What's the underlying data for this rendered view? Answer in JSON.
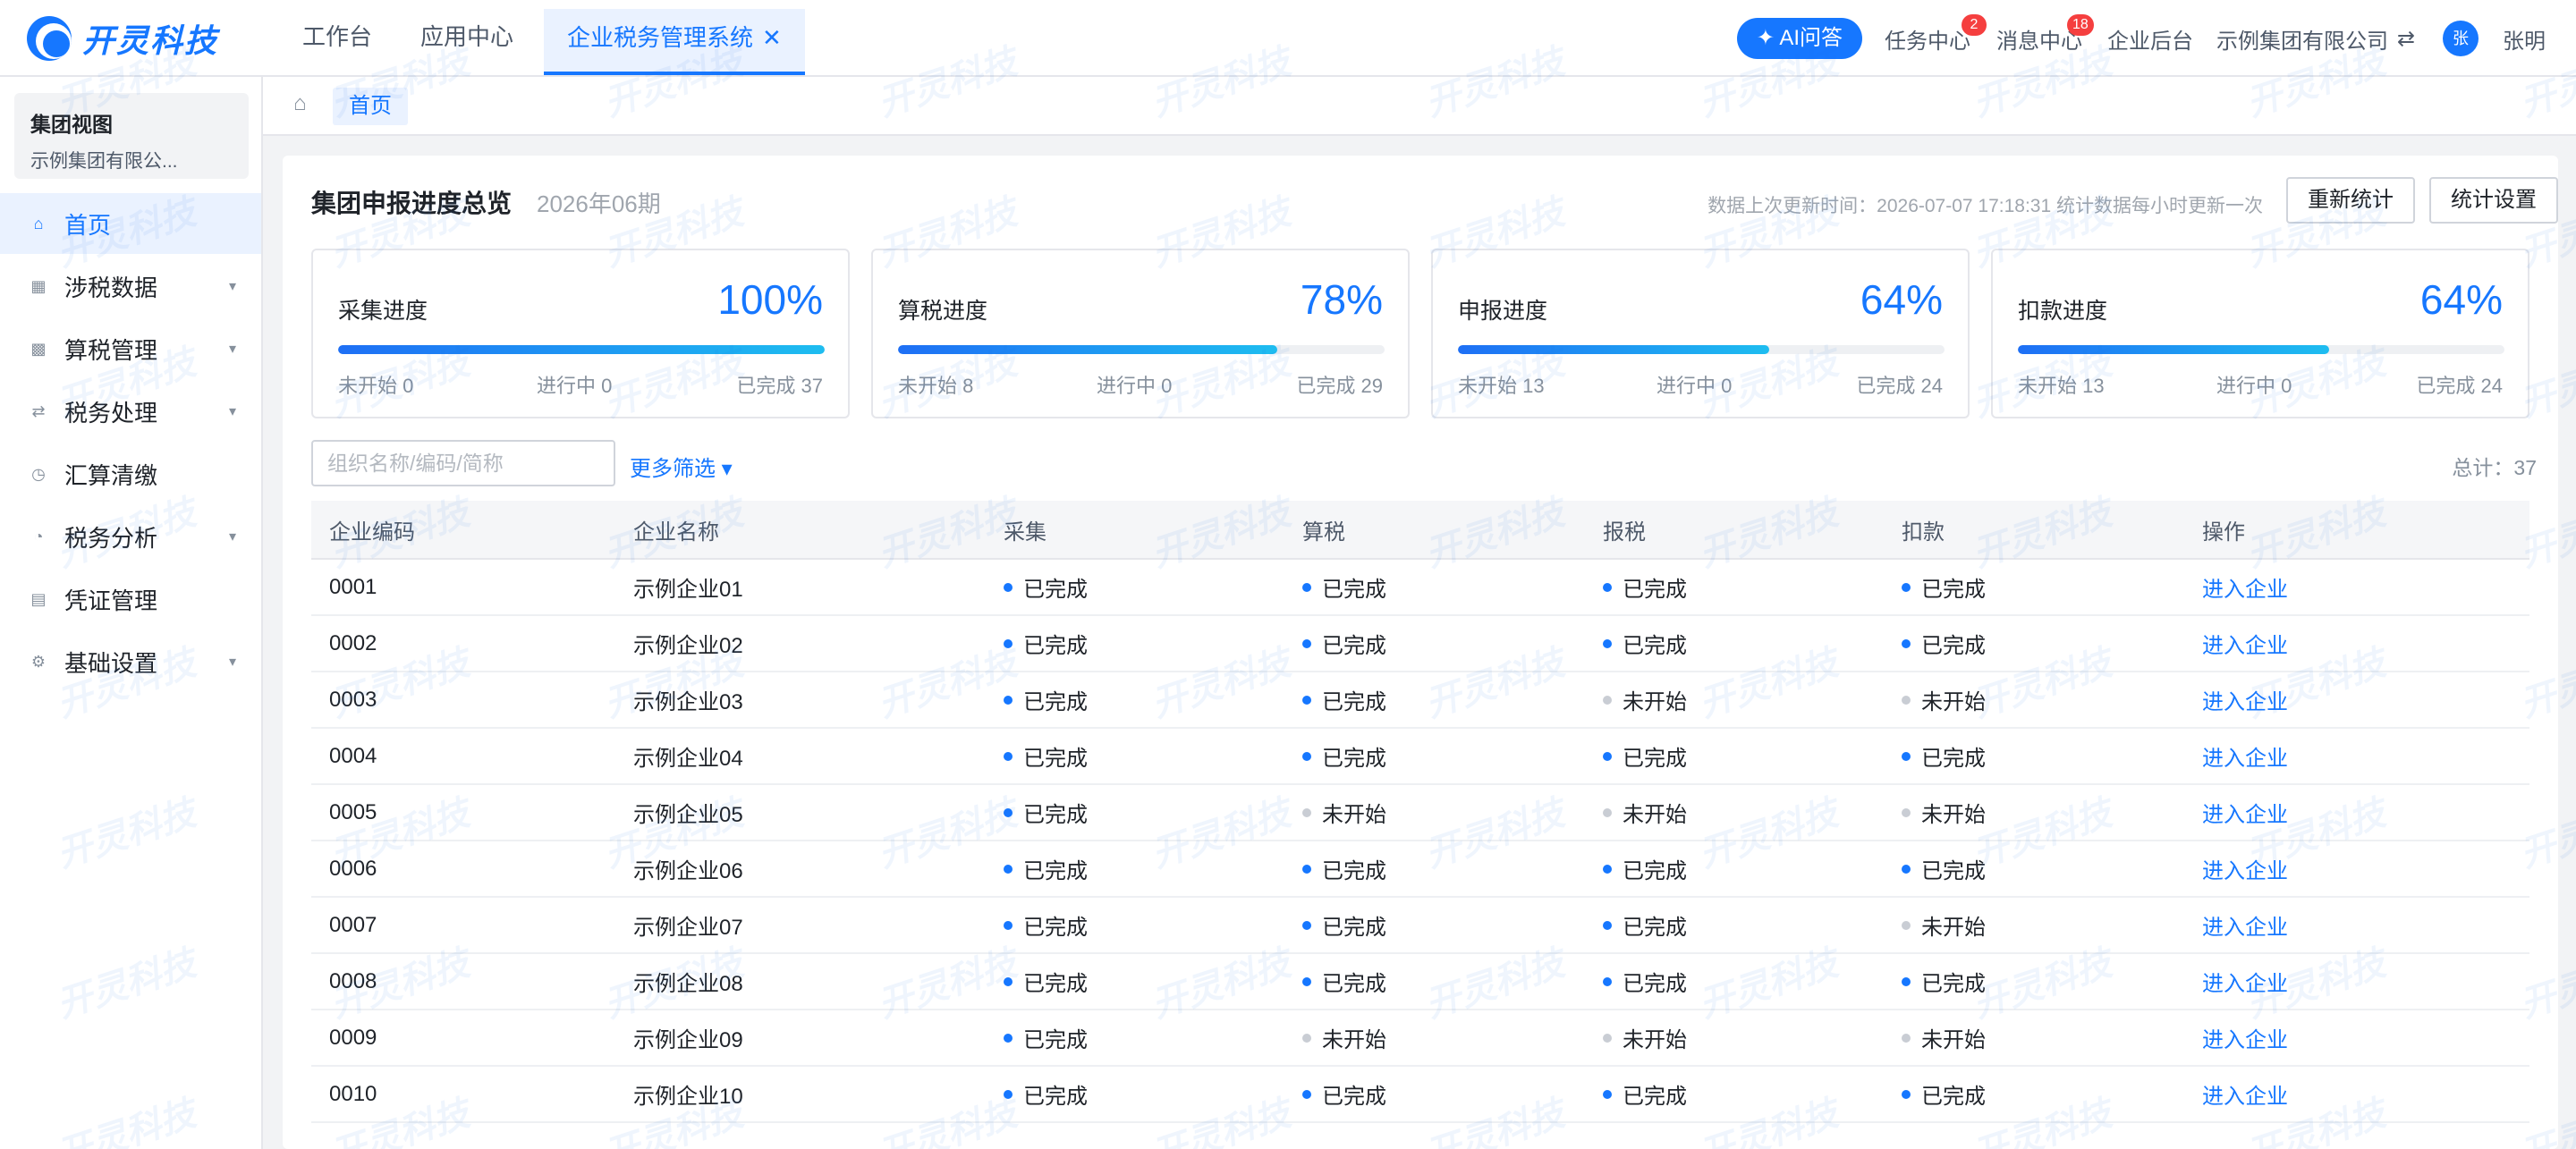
{
  "brand": {
    "name": "开灵科技"
  },
  "topnav": {
    "items": [
      {
        "label": "工作台"
      },
      {
        "label": "应用中心"
      },
      {
        "label": "企业税务管理系统"
      }
    ],
    "close_glyph": "✕"
  },
  "header": {
    "ai_label": "✦ AI问答",
    "tasks_label": "任务中心",
    "tasks_badge": "2",
    "messages_label": "消息中心",
    "messages_badge": "18",
    "admin_label": "企业后台",
    "company_label": "示例集团有限公司",
    "switch_glyph": "⇄",
    "avatar_char": "张",
    "user_name": "张明"
  },
  "sidebar": {
    "group_title": "集团视图",
    "group_sub": "示例集团有限公...",
    "items": [
      {
        "label": "首页",
        "icon": "home-icon",
        "glyph": "⌂",
        "has_children": false
      },
      {
        "label": "涉税数据",
        "icon": "grid-icon",
        "glyph": "▦",
        "has_children": true
      },
      {
        "label": "算税管理",
        "icon": "calc-icon",
        "glyph": "▩",
        "has_children": true
      },
      {
        "label": "税务处理",
        "icon": "swap-icon",
        "glyph": "⇄",
        "has_children": true
      },
      {
        "label": "汇算清缴",
        "icon": "clock-icon",
        "glyph": "◷",
        "has_children": false
      },
      {
        "label": "税务分析",
        "icon": "pie-icon",
        "glyph": "◔",
        "has_children": true
      },
      {
        "label": "凭证管理",
        "icon": "doc-icon",
        "glyph": "▤",
        "has_children": false
      },
      {
        "label": "基础设置",
        "icon": "gear-icon",
        "glyph": "⚙",
        "has_children": true
      }
    ],
    "caret_glyph": "▾"
  },
  "breadcrumb": {
    "home_glyph": "⌂",
    "tab_label": "首页"
  },
  "overview": {
    "title": "集团申报进度总览",
    "period": "2026年06期",
    "update_info": "数据上次更新时间：2026-07-07 17:18:31    统计数据每小时更新一次",
    "recalc_button": "重新统计",
    "settings_button": "统计设置"
  },
  "stats": [
    {
      "label": "采集进度",
      "percent": "100%",
      "fill_percent": 100,
      "not_started": "未开始 0",
      "in_progress": "进行中 0",
      "done": "已完成 37"
    },
    {
      "label": "算税进度",
      "percent": "78%",
      "fill_percent": 78,
      "not_started": "未开始 8",
      "in_progress": "进行中 0",
      "done": "已完成 29"
    },
    {
      "label": "申报进度",
      "percent": "64%",
      "fill_percent": 64,
      "not_started": "未开始 13",
      "in_progress": "进行中 0",
      "done": "已完成 24"
    },
    {
      "label": "扣款进度",
      "percent": "64%",
      "fill_percent": 64,
      "not_started": "未开始 13",
      "in_progress": "进行中 0",
      "done": "已完成 24"
    }
  ],
  "filters": {
    "search_placeholder": "组织名称/编码/简称",
    "more_filters": "更多筛选 ▾",
    "total": "总计：37"
  },
  "table": {
    "columns": [
      "企业编码",
      "企业名称",
      "采集",
      "算税",
      "报税",
      "扣款",
      "操作"
    ],
    "action_label": "进入企业",
    "rows": [
      {
        "code": "0001",
        "name": "示例企业01",
        "collect": "已完成",
        "calc": "已完成",
        "declare": "已完成",
        "deduct": "已完成"
      },
      {
        "code": "0002",
        "name": "示例企业02",
        "collect": "已完成",
        "calc": "已完成",
        "declare": "已完成",
        "deduct": "已完成"
      },
      {
        "code": "0003",
        "name": "示例企业03",
        "collect": "已完成",
        "calc": "已完成",
        "declare": "未开始",
        "deduct": "未开始"
      },
      {
        "code": "0004",
        "name": "示例企业04",
        "collect": "已完成",
        "calc": "已完成",
        "declare": "已完成",
        "deduct": "已完成"
      },
      {
        "code": "0005",
        "name": "示例企业05",
        "collect": "已完成",
        "calc": "未开始",
        "declare": "未开始",
        "deduct": "未开始"
      },
      {
        "code": "0006",
        "name": "示例企业06",
        "collect": "已完成",
        "calc": "已完成",
        "declare": "已完成",
        "deduct": "已完成"
      },
      {
        "code": "0007",
        "name": "示例企业07",
        "collect": "已完成",
        "calc": "已完成",
        "declare": "已完成",
        "deduct": "未开始"
      },
      {
        "code": "0008",
        "name": "示例企业08",
        "collect": "已完成",
        "calc": "已完成",
        "declare": "已完成",
        "deduct": "已完成"
      },
      {
        "code": "0009",
        "name": "示例企业09",
        "collect": "已完成",
        "calc": "未开始",
        "declare": "未开始",
        "deduct": "未开始"
      },
      {
        "code": "0010",
        "name": "示例企业10",
        "collect": "已完成",
        "calc": "已完成",
        "declare": "已完成",
        "deduct": "已完成"
      }
    ]
  },
  "colors": {
    "accent": "#1677ff",
    "pending": "#c9cdd4",
    "badge": "#f53f3f"
  }
}
